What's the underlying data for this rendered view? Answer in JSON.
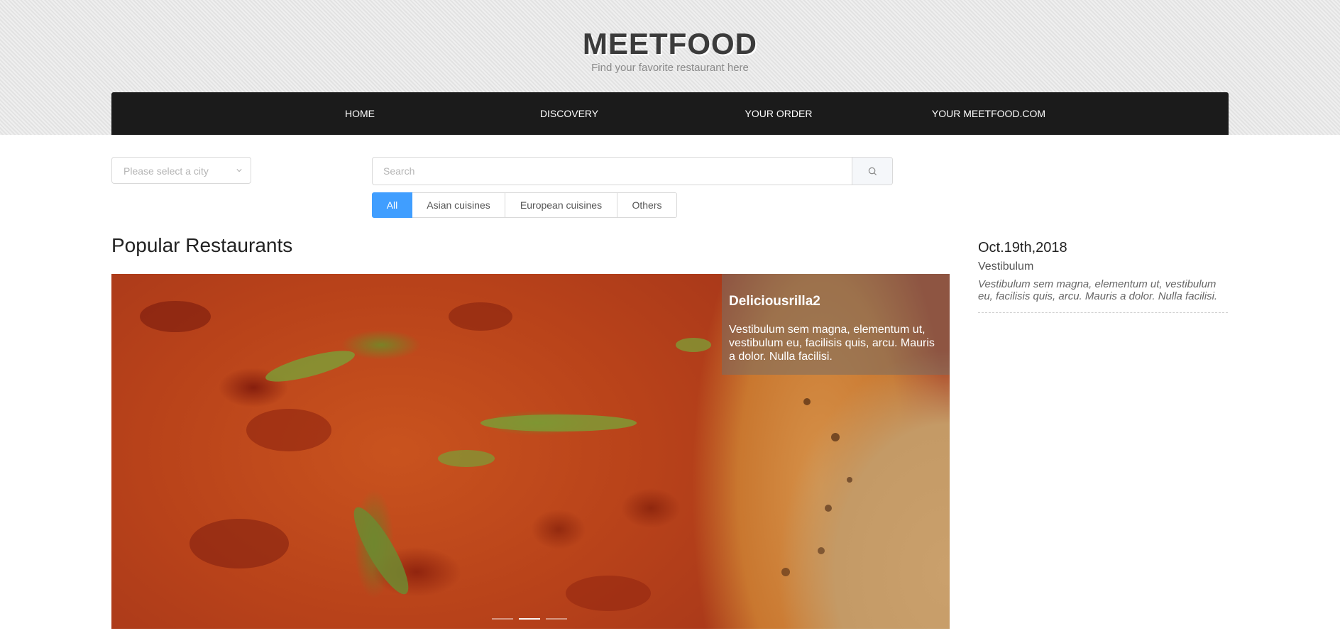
{
  "brand": {
    "name": "MEETFOOD",
    "tagline": "Find your favorite restaurant here"
  },
  "nav": {
    "items": [
      {
        "label": "HOME"
      },
      {
        "label": "DISCOVERY"
      },
      {
        "label": "YOUR ORDER"
      },
      {
        "label": "YOUR MEETFOOD.COM"
      }
    ]
  },
  "city_select": {
    "placeholder": "Please select a city"
  },
  "search": {
    "placeholder": "Search",
    "value": ""
  },
  "filters": [
    {
      "label": "All",
      "active": true
    },
    {
      "label": "Asian cuisines",
      "active": false
    },
    {
      "label": "European cuisines",
      "active": false
    },
    {
      "label": "Others",
      "active": false
    }
  ],
  "popular": {
    "title": "Popular Restaurants",
    "slide": {
      "name": "Deliciousrilla2",
      "description": "Vestibulum sem magna, elementum ut, vestibulum eu, facilisis quis, arcu. Mauris a dolor. Nulla facilisi.",
      "image": "pizza-photo"
    },
    "indicator_count": 3,
    "active_indicator": 2
  },
  "news": {
    "date": "Oct.19th,2018",
    "headline": "Vestibulum",
    "body": "Vestibulum sem magna, elementum ut, vestibulum eu, facilisis quis, arcu. Mauris a dolor. Nulla facilisi."
  },
  "colors": {
    "nav_bg": "#1b1b1b",
    "accent": "#409eff",
    "header_bg": "#e7e7e7"
  }
}
